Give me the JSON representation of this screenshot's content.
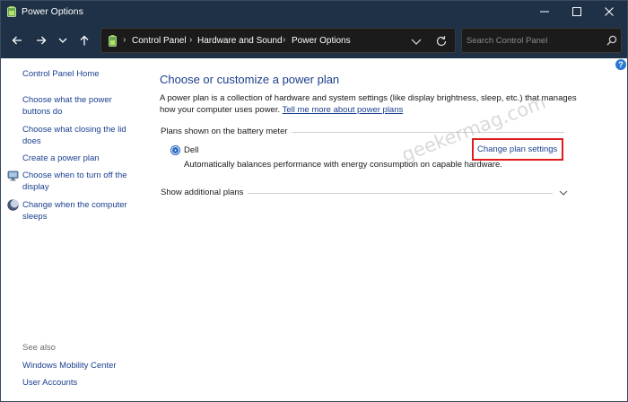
{
  "window": {
    "title": "Power Options",
    "controls": [
      "minimize-icon",
      "maximize-icon",
      "close-icon"
    ]
  },
  "nav": {
    "buttons": [
      "back-arrow-icon",
      "forward-arrow-icon",
      "recent-locations-icon",
      "up-arrow-icon"
    ],
    "breadcrumb": [
      "Control Panel",
      "Hardware and Sound",
      "Power Options"
    ],
    "search_placeholder": "Search Control Panel"
  },
  "sidebar": {
    "home": "Control Panel Home",
    "links": [
      {
        "label": "Choose what the power buttons do",
        "icon": null
      },
      {
        "label": "Choose what closing the lid does",
        "icon": null
      },
      {
        "label": "Create a power plan",
        "icon": null
      },
      {
        "label": "Choose when to turn off the display",
        "icon": "monitor-icon"
      },
      {
        "label": "Change when the computer sleeps",
        "icon": "sleep-moon-icon"
      }
    ],
    "see_also_label": "See also",
    "see_also": [
      "Windows Mobility Center",
      "User Accounts"
    ]
  },
  "main": {
    "title": "Choose or customize a power plan",
    "description": "A power plan is a collection of hardware and system settings (like display brightness, sleep, etc.) that manages how your computer uses power.",
    "description_link": "Tell me more about power plans",
    "section_heading": "Plans shown on the battery meter",
    "plan": {
      "name": "Dell",
      "selected": true,
      "description": "Automatically balances performance with energy consumption on capable hardware.",
      "change_link": "Change plan settings"
    },
    "additional_plans": "Show additional plans"
  },
  "watermark": "geekermag.com",
  "colors": {
    "titlebar": "#1f3146",
    "link": "#1a3f8f",
    "heading": "#1c3e8a",
    "highlight_box": "#e01b1b"
  }
}
